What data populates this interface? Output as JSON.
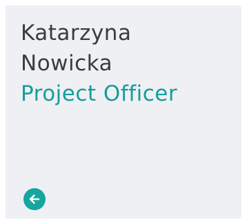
{
  "profile": {
    "first_name": "Katarzyna",
    "last_name": "Nowicka",
    "role": "Project Officer"
  },
  "actions": {
    "back_icon": "arrow-left-icon"
  },
  "colors": {
    "card_background": "#eef0f3",
    "name_text": "#3c3c3c",
    "accent": "#169c9c",
    "button": "#14a69f"
  }
}
